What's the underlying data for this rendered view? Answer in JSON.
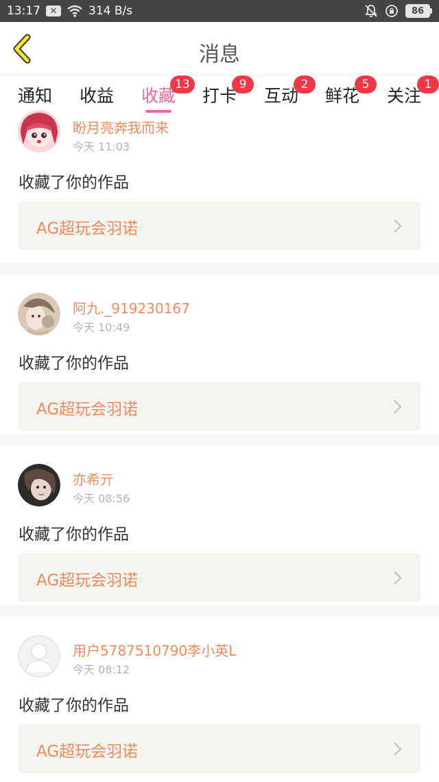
{
  "status_bar": {
    "time": "13:17",
    "notification_icon": "x-box-icon",
    "network_speed": "314 B/s",
    "battery": "86"
  },
  "header": {
    "title": "消息",
    "back_icon": "chevron-left-icon"
  },
  "tabs": [
    {
      "label": "通知",
      "badge": ""
    },
    {
      "label": "收益",
      "badge": ""
    },
    {
      "label": "收藏",
      "badge": "13",
      "active": true
    },
    {
      "label": "打卡",
      "badge": "9"
    },
    {
      "label": "互动",
      "badge": "2"
    },
    {
      "label": "鲜花",
      "badge": "5"
    },
    {
      "label": "关注",
      "badge": "1"
    }
  ],
  "feed": [
    {
      "username": "盼月亮奔我而来",
      "time": "今天 11:03",
      "action": "收藏了你的作品",
      "work_title": "AG超玩会羽诺",
      "avatar": "anime-girl-avatar"
    },
    {
      "username": "阿九._919230167",
      "time": "今天 10:49",
      "action": "收藏了你的作品",
      "work_title": "AG超玩会羽诺",
      "avatar": "photo-avatar"
    },
    {
      "username": "亦希亓",
      "time": "今天 08:56",
      "action": "收藏了你的作品",
      "work_title": "AG超玩会羽诺",
      "avatar": "dark-photo-avatar"
    },
    {
      "username": "用户5787510790李小英L",
      "time": "今天 08:12",
      "action": "收藏了你的作品",
      "work_title": "AG超玩会羽诺",
      "avatar": "default-user-avatar"
    }
  ],
  "colors": {
    "accent_pink": "#e86aa0",
    "username_orange": "#f08a5d",
    "badge_red": "#f23645",
    "card_bg": "#f4f4ee",
    "status_bar": "#454545"
  }
}
